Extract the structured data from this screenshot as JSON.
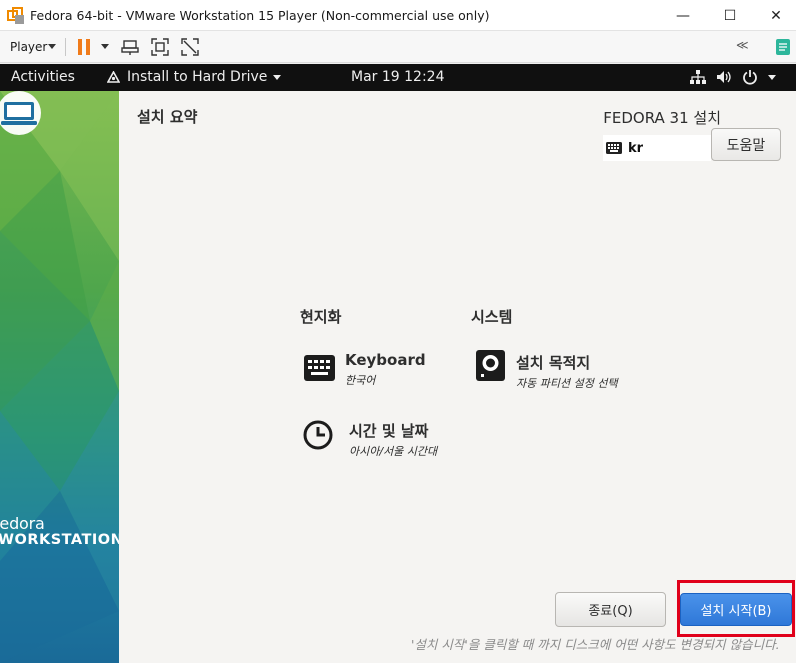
{
  "window": {
    "title": "Fedora 64-bit - VMware Workstation 15 Player (Non-commercial use only)",
    "minimize_glyph": "—",
    "maximize_glyph": "☐",
    "close_glyph": "✕"
  },
  "toolbar": {
    "player_label": "Player",
    "collapse_glyph": "≪"
  },
  "gnome": {
    "activities": "Activities",
    "app_menu": "Install to Hard Drive",
    "clock": "Mar 19  12:24"
  },
  "sidebar": {
    "brand_name": "fedora",
    "brand_edition": "WORKSTATION"
  },
  "installer": {
    "hub_title": "설치 요약",
    "product_title": "FEDORA 31 설치",
    "keyboard_layout": "kr",
    "help_label": "도움말",
    "categories": {
      "localization": "현지화",
      "system": "시스템"
    },
    "spokes": {
      "keyboard": {
        "title": "Keyboard",
        "status": "한국어",
        "icon": "keyboard-icon"
      },
      "datetime": {
        "title": "시간 및 날짜",
        "status": "아시아/서울 시간대",
        "icon": "clock-icon"
      },
      "destination": {
        "title": "설치 목적지",
        "status": "자동 파티션 설정 선택",
        "icon": "disk-icon"
      }
    },
    "quit_label": "종료(Q)",
    "begin_label": "설치 시작(B)",
    "warning": "'설치 시작'을 클릭할 때 까지 디스크에 어떤 사항도 변경되지 않습니다."
  },
  "colors": {
    "gnome_bar": "#101010",
    "primary_button": "#3584e4",
    "highlight_box": "#e0001a",
    "sidebar_green": "#6ab04c",
    "sidebar_blue": "#1f6fa0"
  }
}
